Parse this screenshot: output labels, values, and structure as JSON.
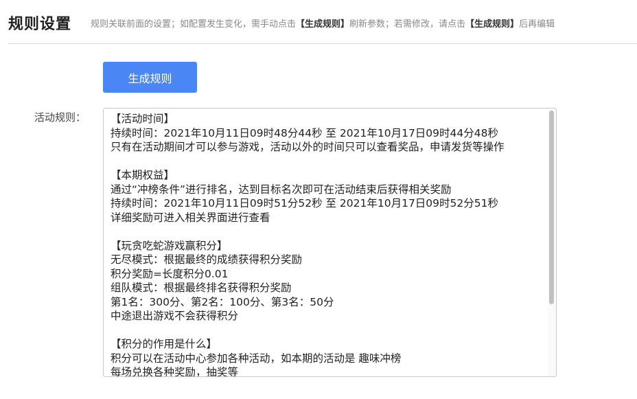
{
  "header": {
    "title": "规则设置",
    "desc_part1": "规则关联前面的设置；如配置发生变化，需手动点击",
    "desc_bold1": "【生成规则】",
    "desc_part2": "刷新参数；若需修改，请点击",
    "desc_bold2": "【生成规则】",
    "desc_part3": "后再编辑"
  },
  "actions": {
    "generate_label": "生成规则"
  },
  "rules": {
    "label": "活动规则：",
    "text": "【活动时间】\n持续时间：2021年10月11日09时48分44秒 至 2021年10月17日09时44分48秒\n只有在活动期间才可以参与游戏，活动以外的时间只可以查看奖品，申请发货等操作\n\n【本期权益】\n通过“冲榜条件”进行排名，达到目标名次即可在活动结束后获得相关奖励\n持续时间：2021年10月11日09时51分52秒 至 2021年10月17日09时52分51秒\n详细奖励可进入相关界面进行查看\n\n【玩贪吃蛇游戏赢积分】\n无尽模式：根据最终的成绩获得积分奖励\n积分奖励=长度积分0.01\n组队模式：根据最终排名获得积分奖励\n第1名：300分、第2名：100分、第3名：50分\n中途退出游戏不会获得积分\n\n【积分的作用是什么】\n积分可以在活动中心参加各种活动，如本期的活动是 趣味冲榜\n每场兑换各种奖励，抽奖等"
  }
}
